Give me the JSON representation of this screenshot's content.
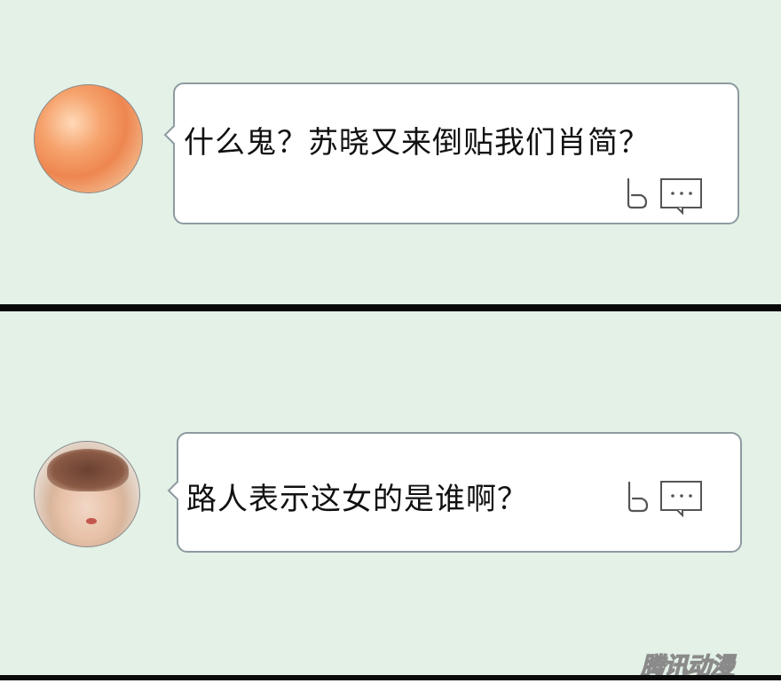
{
  "comments": [
    {
      "text": "什么鬼？苏晓又来倒贴我们肖简？",
      "avatar_icon": "blurred-orange-avatar-icon",
      "actions": [
        "like-icon",
        "comment-icon"
      ]
    },
    {
      "text": "路人表示这女的是谁啊？",
      "avatar_icon": "blurred-person-avatar-icon",
      "actions": [
        "like-icon",
        "comment-icon"
      ]
    }
  ],
  "watermark": "腾讯动漫",
  "colors": {
    "panel_background": "#e3f1e6",
    "bubble_border": "#8d9aa0",
    "divider": "#0a0a0a"
  }
}
